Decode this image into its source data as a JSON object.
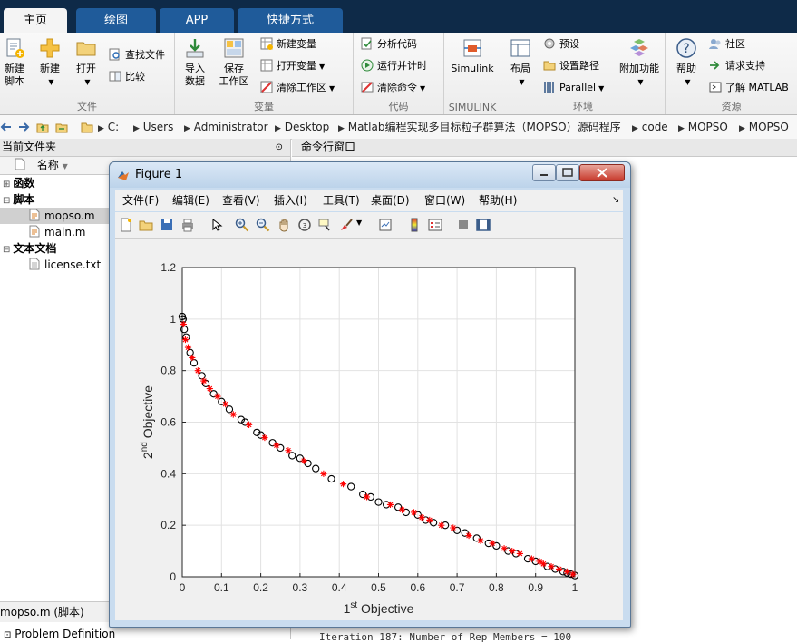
{
  "tabs": [
    "主页",
    "绘图",
    "APP",
    "快捷方式"
  ],
  "ribbon": {
    "file": {
      "name": "文件",
      "new_script": "新建\n脚本",
      "new": "新建",
      "open": "打开",
      "find_files": "查找文件",
      "compare": "比较"
    },
    "variable": {
      "name": "变量",
      "import": "导入\n数据",
      "save_ws": "保存\n工作区",
      "new_var": "新建变量",
      "open_var": "打开变量",
      "clear_ws": "清除工作区"
    },
    "code": {
      "name": "代码",
      "analyze": "分析代码",
      "run_time": "运行并计时",
      "clear_cmd": "清除命令"
    },
    "simulink": {
      "name": "SIMULINK",
      "simulink": "Simulink"
    },
    "env": {
      "name": "环境",
      "layout": "布局",
      "prefs": "预设",
      "set_path": "设置路径",
      "parallel": "Parallel",
      "addons": "附加功能"
    },
    "resources": {
      "name": "资源",
      "help": "帮助",
      "community": "社区",
      "support": "请求支持",
      "learn": "了解 MATLAB"
    }
  },
  "address": [
    "C:",
    "Users",
    "Administrator",
    "Desktop",
    "Matlab编程实现多目标粒子群算法（MOPSO）源码程序",
    "code",
    "MOPSO",
    "MOPSO"
  ],
  "file_panel": {
    "title": "当前文件夹",
    "col_name": "名称",
    "groups": [
      "函数",
      "脚本",
      "文本文档"
    ],
    "files": {
      "mopso": "mopso.m",
      "main": "main.m",
      "license": "license.txt"
    },
    "detail_title": "mopso.m  (脚本)",
    "detail_item": "Problem Definition"
  },
  "command": {
    "title": "命令行窗口",
    "visible_line": "Iteration 187: Number of Rep Members = 100"
  },
  "figure": {
    "title": "Figure 1",
    "menu": [
      "文件(F)",
      "编辑(E)",
      "查看(V)",
      "插入(I)",
      "工具(T)",
      "桌面(D)",
      "窗口(W)",
      "帮助(H)"
    ]
  },
  "chart_data": {
    "type": "scatter",
    "xlim": [
      0,
      1
    ],
    "ylim": [
      0,
      1.2
    ],
    "xticks": [
      "0",
      "0.1",
      "0.2",
      "0.3",
      "0.4",
      "0.5",
      "0.6",
      "0.7",
      "0.8",
      "0.9",
      "1"
    ],
    "yticks": [
      "0",
      "0.2",
      "0.4",
      "0.6",
      "0.8",
      "1",
      "1.2"
    ],
    "xlabel": {
      "pre": "1",
      "sup": "st",
      "post": " Objective"
    },
    "ylabel": {
      "pre": "2",
      "sup": "nd",
      "post": " Objective"
    },
    "grid": true,
    "series": [
      {
        "marker": "o",
        "color": "#000000",
        "x": [
          0,
          0.002,
          0.005,
          0.01,
          0.02,
          0.03,
          0.05,
          0.06,
          0.08,
          0.1,
          0.12,
          0.15,
          0.16,
          0.19,
          0.2,
          0.23,
          0.25,
          0.28,
          0.3,
          0.32,
          0.34,
          0.38,
          0.43,
          0.46,
          0.48,
          0.5,
          0.52,
          0.55,
          0.57,
          0.6,
          0.62,
          0.64,
          0.67,
          0.7,
          0.72,
          0.75,
          0.78,
          0.8,
          0.83,
          0.85,
          0.88,
          0.9,
          0.93,
          0.95,
          0.97,
          0.98,
          0.99,
          1
        ],
        "y": [
          1.01,
          1.0,
          0.96,
          0.93,
          0.87,
          0.83,
          0.78,
          0.75,
          0.71,
          0.68,
          0.65,
          0.61,
          0.6,
          0.56,
          0.55,
          0.52,
          0.5,
          0.47,
          0.46,
          0.44,
          0.42,
          0.38,
          0.35,
          0.32,
          0.31,
          0.29,
          0.28,
          0.27,
          0.25,
          0.24,
          0.22,
          0.21,
          0.2,
          0.18,
          0.17,
          0.15,
          0.13,
          0.12,
          0.1,
          0.09,
          0.07,
          0.06,
          0.04,
          0.03,
          0.02,
          0.015,
          0.01,
          0.005
        ]
      },
      {
        "marker": "*",
        "color": "#ff0000",
        "x": [
          0.003,
          0.008,
          0.015,
          0.025,
          0.04,
          0.055,
          0.07,
          0.09,
          0.11,
          0.13,
          0.17,
          0.21,
          0.24,
          0.27,
          0.31,
          0.36,
          0.41,
          0.47,
          0.53,
          0.56,
          0.59,
          0.61,
          0.63,
          0.66,
          0.69,
          0.73,
          0.76,
          0.79,
          0.82,
          0.84,
          0.86,
          0.89,
          0.91,
          0.92,
          0.94,
          0.96,
          0.98,
          0.995
        ],
        "y": [
          0.98,
          0.92,
          0.89,
          0.85,
          0.8,
          0.76,
          0.73,
          0.7,
          0.67,
          0.63,
          0.59,
          0.54,
          0.51,
          0.49,
          0.45,
          0.4,
          0.36,
          0.31,
          0.28,
          0.26,
          0.25,
          0.23,
          0.22,
          0.2,
          0.19,
          0.16,
          0.14,
          0.13,
          0.11,
          0.1,
          0.09,
          0.07,
          0.06,
          0.05,
          0.04,
          0.03,
          0.02,
          0.01
        ]
      }
    ]
  }
}
